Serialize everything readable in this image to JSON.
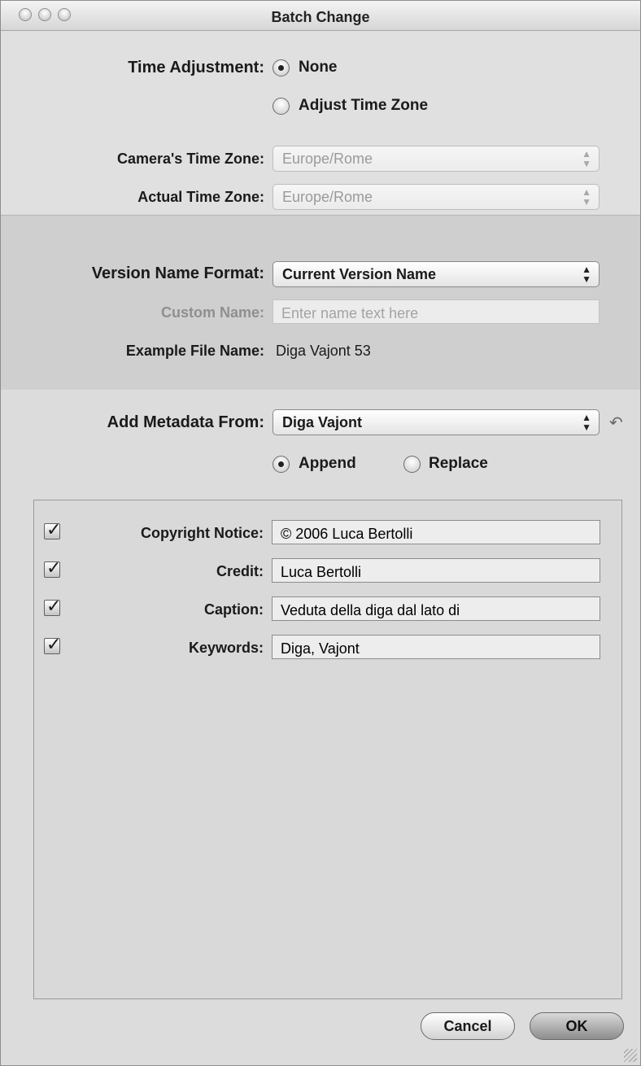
{
  "window": {
    "title": "Batch Change"
  },
  "time": {
    "label": "Time Adjustment:",
    "option_none": "None",
    "option_adjust": "Adjust Time Zone",
    "camera_label": "Camera's Time Zone:",
    "camera_value": "Europe/Rome",
    "actual_label": "Actual Time Zone:",
    "actual_value": "Europe/Rome"
  },
  "version": {
    "format_label": "Version Name Format:",
    "format_value": "Current Version Name",
    "custom_label": "Custom Name:",
    "custom_placeholder": "Enter name text here",
    "example_label": "Example File Name:",
    "example_value": "Diga Vajont 53"
  },
  "metadata": {
    "label": "Add Metadata From:",
    "value": "Diga Vajont",
    "append": "Append",
    "replace": "Replace",
    "fields": [
      {
        "label": "Copyright Notice:",
        "value": "© 2006 Luca Bertolli"
      },
      {
        "label": "Credit:",
        "value": "Luca Bertolli"
      },
      {
        "label": "Caption:",
        "value": "Veduta della diga dal lato di"
      },
      {
        "label": "Keywords:",
        "value": "Diga, Vajont"
      }
    ]
  },
  "buttons": {
    "cancel": "Cancel",
    "ok": "OK"
  }
}
